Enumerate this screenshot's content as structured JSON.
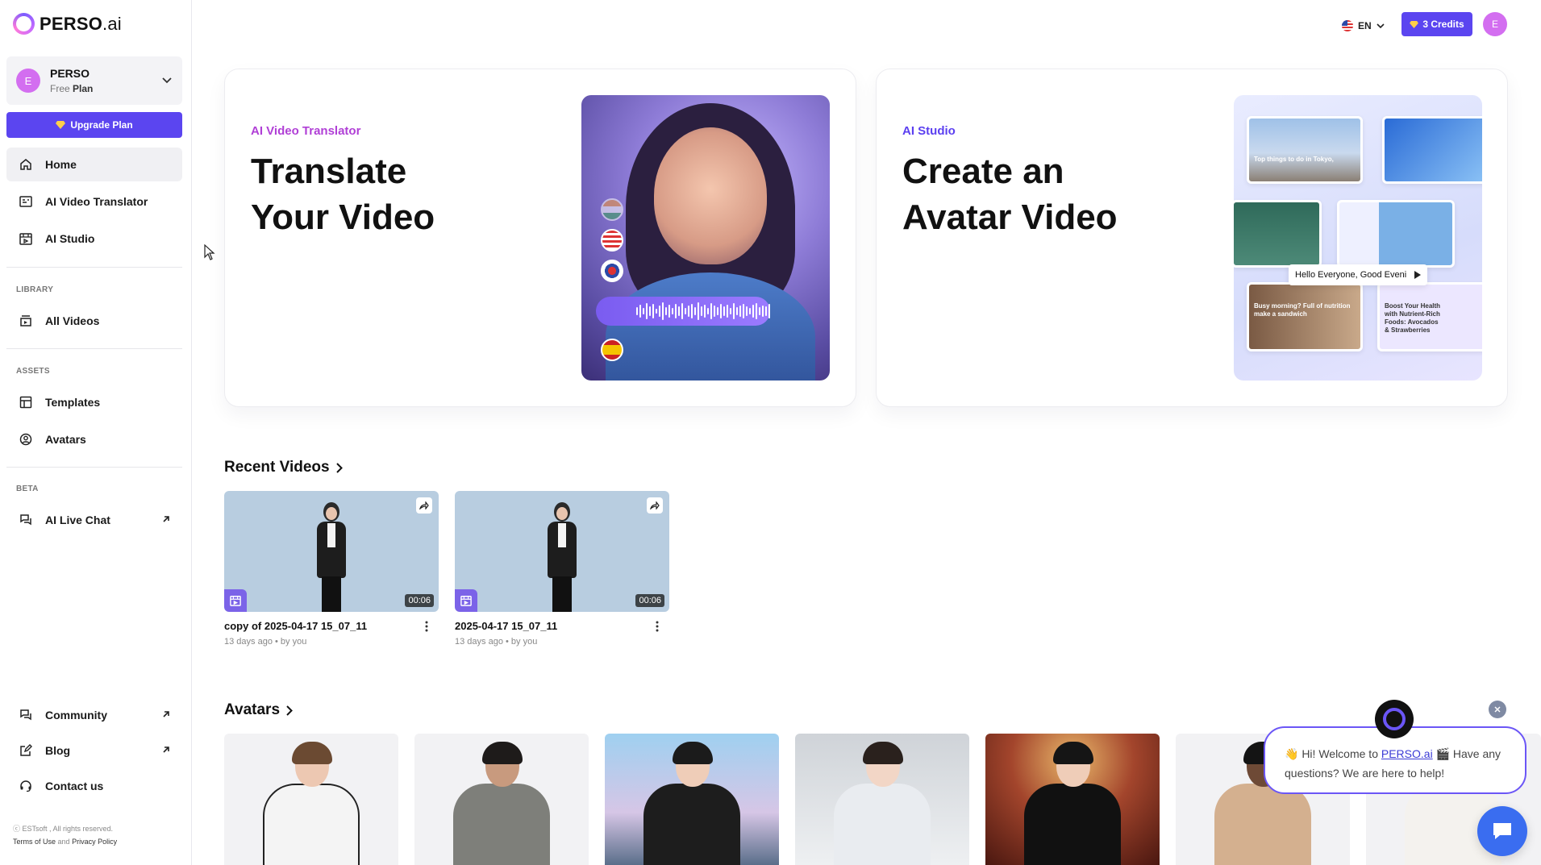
{
  "brand": {
    "name_bold": "PERSO",
    "name_light": ".ai"
  },
  "workspace": {
    "initial": "E",
    "name": "PERSO",
    "plan_prefix": "Free",
    "plan_suffix": "Plan"
  },
  "upgrade_label": "Upgrade Plan",
  "nav": {
    "home": "Home",
    "ai_video_translator": "AI Video Translator",
    "ai_studio": "AI Studio",
    "library_label": "LIBRARY",
    "all_videos": "All Videos",
    "assets_label": "ASSETS",
    "templates": "Templates",
    "avatars": "Avatars",
    "beta_label": "BETA",
    "ai_live_chat": "AI Live Chat",
    "community": "Community",
    "blog": "Blog",
    "contact_us": "Contact us"
  },
  "footer": {
    "copyright": "ⓒ ESTsoft , All rights reserved.",
    "terms": "Terms of Use",
    "and": "and",
    "privacy": "Privacy Policy"
  },
  "topbar": {
    "language": "EN",
    "credits": "3 Credits",
    "user_initial": "E"
  },
  "cards": {
    "translator": {
      "eyebrow": "AI Video Translator",
      "title_line1": "Translate",
      "title_line2": "Your Video",
      "eyebrow_color": "#b03fd6"
    },
    "studio": {
      "eyebrow": "AI Studio",
      "title_line1": "Create an",
      "title_line2": "Avatar Video",
      "eyebrow_color": "#5b3ff0",
      "thumb1_text": "Top things to do in Tokyo,",
      "thumb2_text": "Busy morning? Full of nutrition make a sandwich",
      "thumb3_text": "Boost Your Health with Nutrient-Rich Foods: Avocados & Strawberries",
      "caption": "Hello Everyone, Good Eveni"
    }
  },
  "recent_videos": {
    "title": "Recent Videos",
    "items": [
      {
        "title": "copy of 2025-04-17 15_07_11",
        "time": "13 days ago",
        "sep": "•",
        "author": "by you",
        "duration": "00:06"
      },
      {
        "title": "2025-04-17 15_07_11",
        "time": "13 days ago",
        "sep": "•",
        "author": "by you",
        "duration": "00:06"
      }
    ]
  },
  "avatars_section": {
    "title": "Avatars"
  },
  "chat": {
    "greeting_start": "👋 Hi! Welcome to ",
    "link": "PERSO.ai",
    "greeting_end": " 🎬 Have any questions? We are here to help!"
  },
  "colors": {
    "accent": "#5b45f0",
    "avatar_pink": "#d36ef0",
    "chat_blue": "#3a6df0"
  }
}
